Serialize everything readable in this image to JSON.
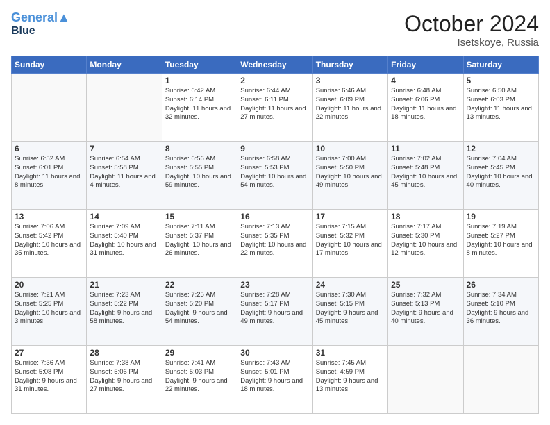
{
  "header": {
    "logo_line1": "General",
    "logo_line2": "Blue",
    "month": "October 2024",
    "location": "Isetskoye, Russia"
  },
  "weekdays": [
    "Sunday",
    "Monday",
    "Tuesday",
    "Wednesday",
    "Thursday",
    "Friday",
    "Saturday"
  ],
  "weeks": [
    [
      {
        "day": "",
        "sunrise": "",
        "sunset": "",
        "daylight": ""
      },
      {
        "day": "",
        "sunrise": "",
        "sunset": "",
        "daylight": ""
      },
      {
        "day": "1",
        "sunrise": "Sunrise: 6:42 AM",
        "sunset": "Sunset: 6:14 PM",
        "daylight": "Daylight: 11 hours and 32 minutes."
      },
      {
        "day": "2",
        "sunrise": "Sunrise: 6:44 AM",
        "sunset": "Sunset: 6:11 PM",
        "daylight": "Daylight: 11 hours and 27 minutes."
      },
      {
        "day": "3",
        "sunrise": "Sunrise: 6:46 AM",
        "sunset": "Sunset: 6:09 PM",
        "daylight": "Daylight: 11 hours and 22 minutes."
      },
      {
        "day": "4",
        "sunrise": "Sunrise: 6:48 AM",
        "sunset": "Sunset: 6:06 PM",
        "daylight": "Daylight: 11 hours and 18 minutes."
      },
      {
        "day": "5",
        "sunrise": "Sunrise: 6:50 AM",
        "sunset": "Sunset: 6:03 PM",
        "daylight": "Daylight: 11 hours and 13 minutes."
      }
    ],
    [
      {
        "day": "6",
        "sunrise": "Sunrise: 6:52 AM",
        "sunset": "Sunset: 6:01 PM",
        "daylight": "Daylight: 11 hours and 8 minutes."
      },
      {
        "day": "7",
        "sunrise": "Sunrise: 6:54 AM",
        "sunset": "Sunset: 5:58 PM",
        "daylight": "Daylight: 11 hours and 4 minutes."
      },
      {
        "day": "8",
        "sunrise": "Sunrise: 6:56 AM",
        "sunset": "Sunset: 5:55 PM",
        "daylight": "Daylight: 10 hours and 59 minutes."
      },
      {
        "day": "9",
        "sunrise": "Sunrise: 6:58 AM",
        "sunset": "Sunset: 5:53 PM",
        "daylight": "Daylight: 10 hours and 54 minutes."
      },
      {
        "day": "10",
        "sunrise": "Sunrise: 7:00 AM",
        "sunset": "Sunset: 5:50 PM",
        "daylight": "Daylight: 10 hours and 49 minutes."
      },
      {
        "day": "11",
        "sunrise": "Sunrise: 7:02 AM",
        "sunset": "Sunset: 5:48 PM",
        "daylight": "Daylight: 10 hours and 45 minutes."
      },
      {
        "day": "12",
        "sunrise": "Sunrise: 7:04 AM",
        "sunset": "Sunset: 5:45 PM",
        "daylight": "Daylight: 10 hours and 40 minutes."
      }
    ],
    [
      {
        "day": "13",
        "sunrise": "Sunrise: 7:06 AM",
        "sunset": "Sunset: 5:42 PM",
        "daylight": "Daylight: 10 hours and 35 minutes."
      },
      {
        "day": "14",
        "sunrise": "Sunrise: 7:09 AM",
        "sunset": "Sunset: 5:40 PM",
        "daylight": "Daylight: 10 hours and 31 minutes."
      },
      {
        "day": "15",
        "sunrise": "Sunrise: 7:11 AM",
        "sunset": "Sunset: 5:37 PM",
        "daylight": "Daylight: 10 hours and 26 minutes."
      },
      {
        "day": "16",
        "sunrise": "Sunrise: 7:13 AM",
        "sunset": "Sunset: 5:35 PM",
        "daylight": "Daylight: 10 hours and 22 minutes."
      },
      {
        "day": "17",
        "sunrise": "Sunrise: 7:15 AM",
        "sunset": "Sunset: 5:32 PM",
        "daylight": "Daylight: 10 hours and 17 minutes."
      },
      {
        "day": "18",
        "sunrise": "Sunrise: 7:17 AM",
        "sunset": "Sunset: 5:30 PM",
        "daylight": "Daylight: 10 hours and 12 minutes."
      },
      {
        "day": "19",
        "sunrise": "Sunrise: 7:19 AM",
        "sunset": "Sunset: 5:27 PM",
        "daylight": "Daylight: 10 hours and 8 minutes."
      }
    ],
    [
      {
        "day": "20",
        "sunrise": "Sunrise: 7:21 AM",
        "sunset": "Sunset: 5:25 PM",
        "daylight": "Daylight: 10 hours and 3 minutes."
      },
      {
        "day": "21",
        "sunrise": "Sunrise: 7:23 AM",
        "sunset": "Sunset: 5:22 PM",
        "daylight": "Daylight: 9 hours and 58 minutes."
      },
      {
        "day": "22",
        "sunrise": "Sunrise: 7:25 AM",
        "sunset": "Sunset: 5:20 PM",
        "daylight": "Daylight: 9 hours and 54 minutes."
      },
      {
        "day": "23",
        "sunrise": "Sunrise: 7:28 AM",
        "sunset": "Sunset: 5:17 PM",
        "daylight": "Daylight: 9 hours and 49 minutes."
      },
      {
        "day": "24",
        "sunrise": "Sunrise: 7:30 AM",
        "sunset": "Sunset: 5:15 PM",
        "daylight": "Daylight: 9 hours and 45 minutes."
      },
      {
        "day": "25",
        "sunrise": "Sunrise: 7:32 AM",
        "sunset": "Sunset: 5:13 PM",
        "daylight": "Daylight: 9 hours and 40 minutes."
      },
      {
        "day": "26",
        "sunrise": "Sunrise: 7:34 AM",
        "sunset": "Sunset: 5:10 PM",
        "daylight": "Daylight: 9 hours and 36 minutes."
      }
    ],
    [
      {
        "day": "27",
        "sunrise": "Sunrise: 7:36 AM",
        "sunset": "Sunset: 5:08 PM",
        "daylight": "Daylight: 9 hours and 31 minutes."
      },
      {
        "day": "28",
        "sunrise": "Sunrise: 7:38 AM",
        "sunset": "Sunset: 5:06 PM",
        "daylight": "Daylight: 9 hours and 27 minutes."
      },
      {
        "day": "29",
        "sunrise": "Sunrise: 7:41 AM",
        "sunset": "Sunset: 5:03 PM",
        "daylight": "Daylight: 9 hours and 22 minutes."
      },
      {
        "day": "30",
        "sunrise": "Sunrise: 7:43 AM",
        "sunset": "Sunset: 5:01 PM",
        "daylight": "Daylight: 9 hours and 18 minutes."
      },
      {
        "day": "31",
        "sunrise": "Sunrise: 7:45 AM",
        "sunset": "Sunset: 4:59 PM",
        "daylight": "Daylight: 9 hours and 13 minutes."
      },
      {
        "day": "",
        "sunrise": "",
        "sunset": "",
        "daylight": ""
      },
      {
        "day": "",
        "sunrise": "",
        "sunset": "",
        "daylight": ""
      }
    ]
  ]
}
